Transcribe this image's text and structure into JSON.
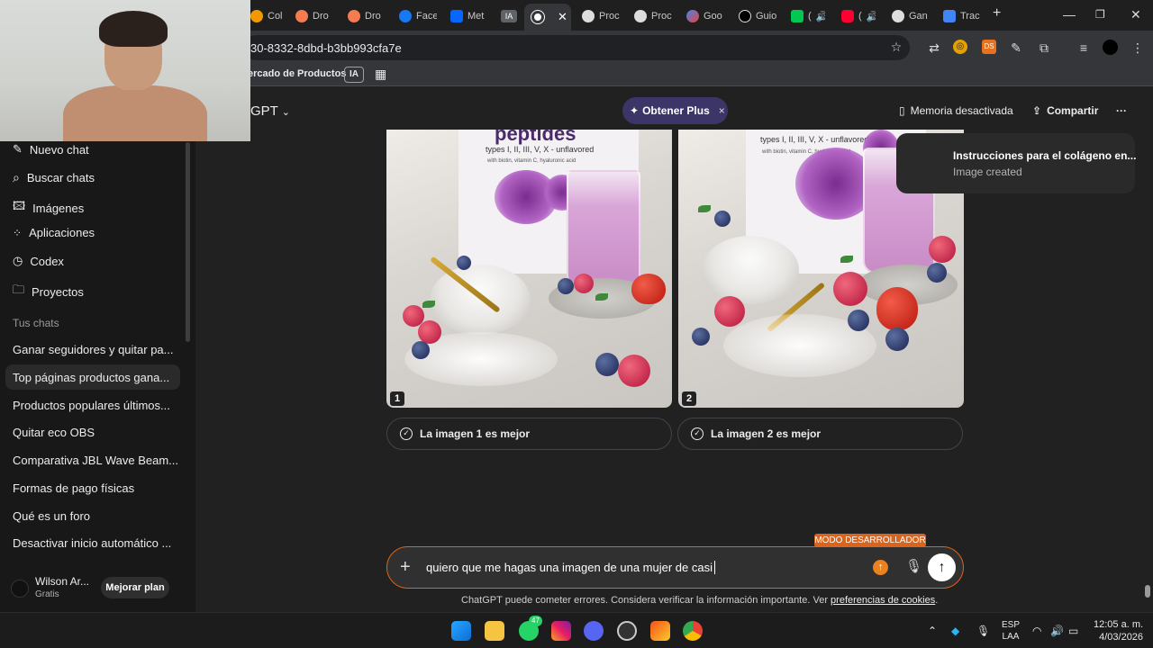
{
  "browser": {
    "tabs": [
      {
        "label": "Col",
        "color": "#f29900"
      },
      {
        "label": "Dro",
        "color": "#f57c50"
      },
      {
        "label": "Dro",
        "color": "#f57c50"
      },
      {
        "label": "Face",
        "color": "#1877f2"
      },
      {
        "label": "Met",
        "color": "#0866ff"
      },
      {
        "label": "IA",
        "color": "#9aa0a6"
      },
      {
        "label": "",
        "color": "#ffffff"
      },
      {
        "label": "Proc",
        "color": "#ffffff"
      },
      {
        "label": "Proc",
        "color": "#ffffff"
      },
      {
        "label": "Goo",
        "color": "#4285f4"
      },
      {
        "label": "Guio",
        "color": "#ffffff"
      },
      {
        "label": "(",
        "color": "#00c853"
      },
      {
        "label": "(",
        "color": "#ff0033"
      },
      {
        "label": "Gan",
        "color": "#ffffff"
      },
      {
        "label": "Trac",
        "color": "#4285f4"
      }
    ],
    "url": "30-8332-8dbd-b3bb993cfa7e",
    "bookmark_label": "ercado de Productos",
    "bookmark_badge": "IA"
  },
  "header": {
    "model": "GPT",
    "plus_label": "Obtener Plus",
    "plus_close": "×",
    "memory": "Memoria desactivada",
    "share": "Compartir",
    "more": "···"
  },
  "sidebar": {
    "actions": [
      {
        "label": "Nuevo chat",
        "icon": "new-chat-icon"
      },
      {
        "label": "Buscar chats",
        "icon": "search-icon"
      },
      {
        "label": "Imágenes",
        "icon": "images-icon"
      },
      {
        "label": "Aplicaciones",
        "icon": "apps-icon"
      },
      {
        "label": "Codex",
        "icon": "codex-icon"
      },
      {
        "label": "Proyectos",
        "icon": "folder-icon"
      }
    ],
    "group_label": "Tus chats",
    "chats": [
      "Ganar seguidores y quitar pa...",
      "Top páginas productos gana...",
      "Productos populares últimos...",
      "Quitar eco OBS",
      "Comparativa JBL Wave Beam...",
      "Formas de pago físicas",
      "Qué es un foro",
      "Desactivar inicio automático ..."
    ],
    "selected_chat": 1,
    "user_name": "Wilson Ar...",
    "user_plan": "Gratis",
    "upgrade_label": "Mejorar plan"
  },
  "images": [
    {
      "number": "1",
      "title": "peptides",
      "sub": "types I, II, III, V, X - unflavored",
      "sub2": "with biotin, vitamin C, hyaluronic acid",
      "choice": "La imagen 1 es mejor"
    },
    {
      "number": "2",
      "title": "",
      "sub": "types I, II, III, V, X - unflavored",
      "sub2": "with biotin, vitamin C, hyaluronic acid",
      "choice": "La imagen 2 es mejor"
    }
  ],
  "toast": {
    "title": "Instrucciones para el colágeno en...",
    "subtitle": "Image created"
  },
  "composer": {
    "dev_badge": "MODO DESARROLLADOR",
    "text": "quiero que me hagas una imagen de una mujer de casi",
    "disclaimer_prefix": "ChatGPT puede cometer errores. Considera verificar la información importante. Ver ",
    "disclaimer_link": "preferencias de cookies",
    "disclaimer_suffix": "."
  },
  "taskbar": {
    "whatsapp_badge": "47",
    "lang": "ESP",
    "lang2": "LAA",
    "time": "12:05 a. m.",
    "date": "4/03/2026"
  }
}
